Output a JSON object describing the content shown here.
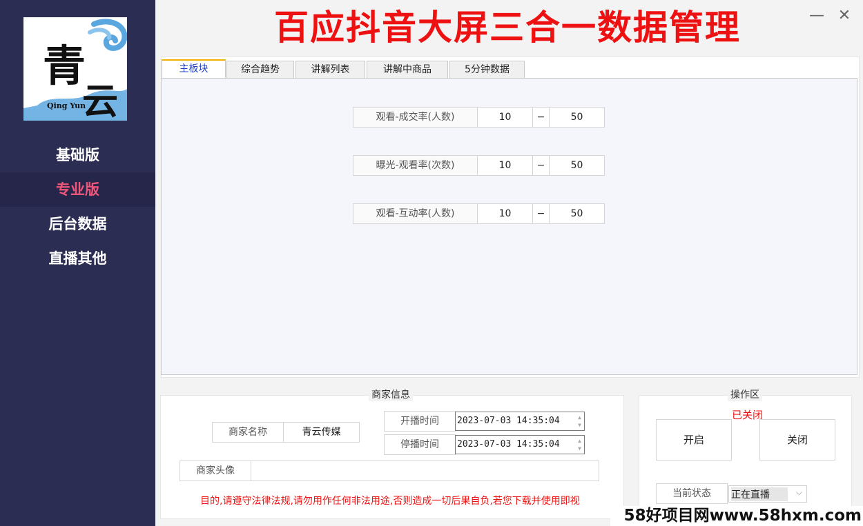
{
  "app": {
    "title": "百应抖音大屏三合一数据管理",
    "minimize_glyph": "—",
    "close_glyph": "✕"
  },
  "logo": {
    "char1": "青",
    "char2": "云",
    "latin": "Qing Yun",
    "icon": "qingyun-logo-icon"
  },
  "sidebar": {
    "items": [
      {
        "label": "基础版",
        "active": false
      },
      {
        "label": "专业版",
        "active": true
      },
      {
        "label": "后台数据",
        "active": false
      },
      {
        "label": "直播其他",
        "active": false
      }
    ]
  },
  "tabs": [
    {
      "label": "主板块",
      "active": true
    },
    {
      "label": "综合趋势",
      "active": false
    },
    {
      "label": "讲解列表",
      "active": false
    },
    {
      "label": "讲解中商品",
      "active": false
    },
    {
      "label": "5分钟数据",
      "active": false
    }
  ],
  "ranges": [
    {
      "label": "观看-成交率(人数)",
      "min": "10",
      "sep": "−",
      "max": "50"
    },
    {
      "label": "曝光-观看率(次数)",
      "min": "10",
      "sep": "−",
      "max": "50"
    },
    {
      "label": "观看-互动率(人数)",
      "min": "10",
      "sep": "−",
      "max": "50"
    }
  ],
  "merchant": {
    "group_title": "商家信息",
    "name_label": "商家名称",
    "name_value": "青云传媒",
    "start_label": "开播时间",
    "start_value": "2023-07-03 14:35:04",
    "stop_label": "停播时间",
    "stop_value": "2023-07-03 14:35:04",
    "avatar_label": "商家头像",
    "avatar_value": "",
    "notice": "目的,请遵守法律法规,请勿用作任何非法用途,否则造成一切后果自负,若您下载并使用即视"
  },
  "ops": {
    "group_title": "操作区",
    "status_text": "已关闭",
    "start_button": "开启",
    "stop_button": "关闭",
    "current_state_label": "当前状态",
    "current_state_value": "正在直播"
  },
  "watermark": "58好项目网www.58hxm.com",
  "colors": {
    "sidebar_bg": "#2c2d52",
    "active_nav": "#f0567a",
    "title_red": "#ee1111",
    "tab_active_text": "#2040c0",
    "tab_accent": "#f0b000"
  }
}
